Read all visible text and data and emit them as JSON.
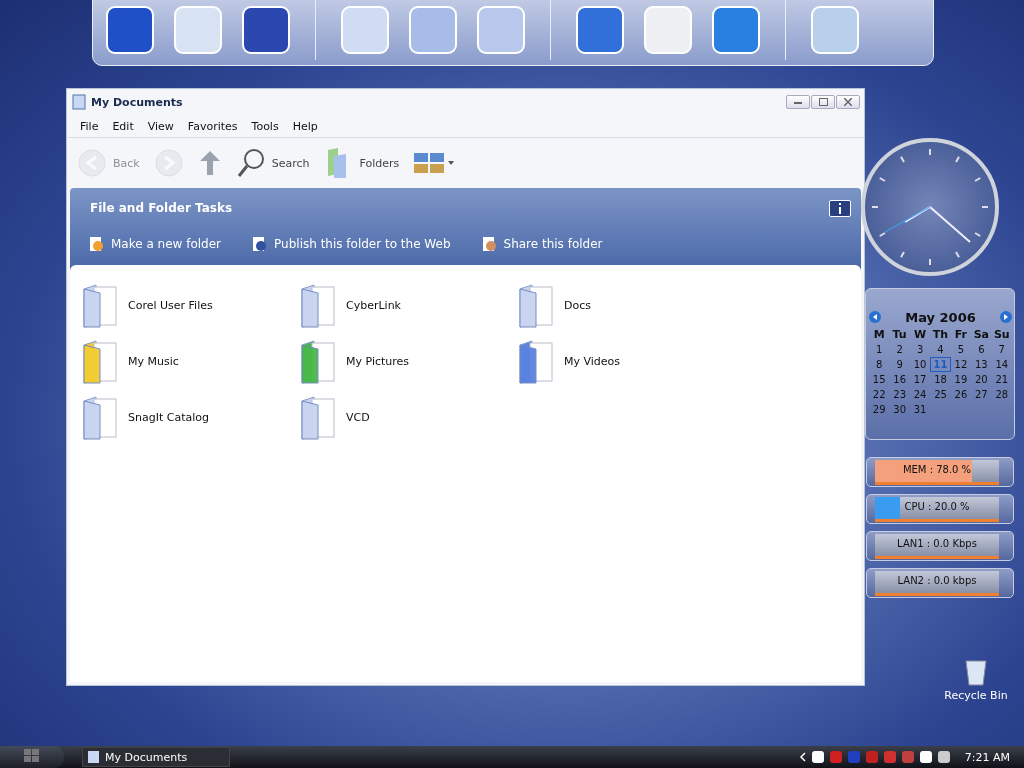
{
  "window": {
    "title": "My Documents",
    "menu": [
      "File",
      "Edit",
      "View",
      "Favorites",
      "Tools",
      "Help"
    ],
    "toolbar": [
      {
        "kind": "back",
        "label": "Back",
        "disabled": true
      },
      {
        "kind": "forward",
        "disabled": true
      },
      {
        "kind": "up",
        "disabled": false
      },
      {
        "kind": "search",
        "label": "Search",
        "disabled": false
      },
      {
        "kind": "folders",
        "label": "Folders",
        "disabled": false
      },
      {
        "kind": "views",
        "disabled": false
      }
    ],
    "tasks": {
      "title": "File and Folder Tasks",
      "links": [
        {
          "kind": "new",
          "label": "Make a new folder"
        },
        {
          "kind": "publish",
          "label": "Publish this folder to the Web"
        },
        {
          "kind": "share",
          "label": "Share this folder"
        }
      ]
    },
    "folders": [
      {
        "name": "Corel User Files",
        "kind": "plain"
      },
      {
        "name": "CyberLink",
        "kind": "plain"
      },
      {
        "name": "Docs",
        "kind": "plain"
      },
      {
        "name": "My Music",
        "kind": "music"
      },
      {
        "name": "My Pictures",
        "kind": "pictures"
      },
      {
        "name": "My Videos",
        "kind": "videos"
      },
      {
        "name": "SnagIt Catalog",
        "kind": "plain"
      },
      {
        "name": "VCD",
        "kind": "plain"
      }
    ]
  },
  "calendar": {
    "month": "May 2006",
    "weekdays": [
      "M",
      "Tu",
      "W",
      "Th",
      "Fr",
      "Sa",
      "Su"
    ],
    "days": [
      {
        "day": "1",
        "selected": false
      },
      {
        "day": "2",
        "selected": false
      },
      {
        "day": "3",
        "selected": false
      },
      {
        "day": "4",
        "selected": false
      },
      {
        "day": "5",
        "selected": false
      },
      {
        "day": "6",
        "selected": false
      },
      {
        "day": "7",
        "selected": false
      },
      {
        "day": "8",
        "selected": false
      },
      {
        "day": "9",
        "selected": false
      },
      {
        "day": "10",
        "selected": false
      },
      {
        "day": "11",
        "selected": true
      },
      {
        "day": "12",
        "selected": false
      },
      {
        "day": "13",
        "selected": false
      },
      {
        "day": "14",
        "selected": false
      },
      {
        "day": "15",
        "selected": false
      },
      {
        "day": "16",
        "selected": false
      },
      {
        "day": "17",
        "selected": false
      },
      {
        "day": "18",
        "selected": false
      },
      {
        "day": "19",
        "selected": false
      },
      {
        "day": "20",
        "selected": false
      },
      {
        "day": "21",
        "selected": false
      },
      {
        "day": "22",
        "selected": false
      },
      {
        "day": "23",
        "selected": false
      },
      {
        "day": "24",
        "selected": false
      },
      {
        "day": "25",
        "selected": false
      },
      {
        "day": "26",
        "selected": false
      },
      {
        "day": "27",
        "selected": false
      },
      {
        "day": "28",
        "selected": false
      },
      {
        "day": "29",
        "selected": false
      },
      {
        "day": "30",
        "selected": false
      },
      {
        "day": "31",
        "selected": false
      }
    ]
  },
  "meters": [
    {
      "label": "MEM : 78.0 %",
      "level": 0.78,
      "color": "#f4a07c"
    },
    {
      "label": "CPU : 20.0 %",
      "level": 0.2,
      "color": "#3a9cf0"
    },
    {
      "label": "LAN1 : 0.0 Kbps"
    },
    {
      "label": "LAN2 : 0.0 kbps"
    }
  ],
  "desktop_icons": [
    {
      "label": "Recycle Bin"
    }
  ],
  "taskbar": {
    "tasks": [
      {
        "label": "My Documents",
        "selected": true
      }
    ],
    "clock": "7:21 AM"
  }
}
